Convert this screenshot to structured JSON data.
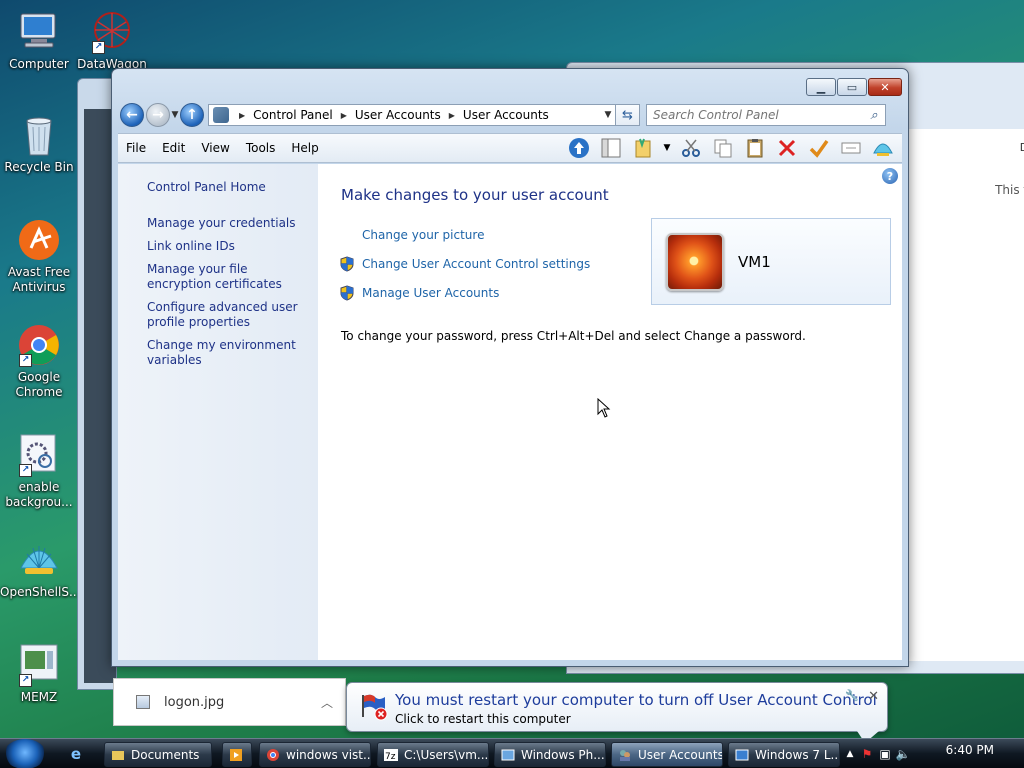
{
  "desktop": {
    "icons": [
      {
        "label": "Computer",
        "icon": "computer-icon"
      },
      {
        "label": "DataWagon",
        "icon": "datawagon-icon"
      },
      {
        "label": "Recycle Bin",
        "icon": "recycle-bin-icon"
      },
      {
        "label": "Avast Free Antivirus",
        "icon": "avast-icon"
      },
      {
        "label": "Google Chrome",
        "icon": "chrome-icon"
      },
      {
        "label": "enable backgrou...",
        "icon": "settings-icon"
      },
      {
        "label": "OpenShellS...",
        "icon": "openshell-icon"
      },
      {
        "label": "MEMZ",
        "icon": "memz-icon"
      }
    ]
  },
  "window": {
    "address": {
      "crumbs": [
        "Control Panel",
        "User Accounts",
        "User Accounts"
      ]
    },
    "search": {
      "placeholder": "Search Control Panel"
    },
    "menu": [
      "File",
      "Edit",
      "View",
      "Tools",
      "Help"
    ],
    "left_pane": {
      "home": "Control Panel Home",
      "links": [
        "Manage your credentials",
        "Link online IDs",
        "Manage your file encryption certificates",
        "Configure advanced user profile properties",
        "Change my environment variables"
      ]
    },
    "main": {
      "heading": "Make changes to your user account",
      "tasks": [
        {
          "label": "Change your picture",
          "shield": false
        },
        {
          "label": "Change User Account Control settings",
          "shield": true
        },
        {
          "label": "Manage User Accounts",
          "shield": true
        }
      ],
      "password_note": "To change your password, press Ctrl+Alt+Del and select Change a password.",
      "user": {
        "name": "VM1"
      }
    }
  },
  "download": {
    "filename": "logon.jpg"
  },
  "balloon": {
    "title": "You must restart your computer to turn off User Account Control",
    "subtitle": "Click to restart this computer"
  },
  "taskbar": {
    "buttons": [
      {
        "label": "Documents",
        "active": false
      },
      {
        "label": "windows vist...",
        "active": false
      },
      {
        "label": "C:\\Users\\vm...",
        "active": false
      },
      {
        "label": "Windows Ph...",
        "active": false
      },
      {
        "label": "User Accounts",
        "active": true
      },
      {
        "label": "Windows 7 L...",
        "active": false
      }
    ],
    "clock": "6:40 PM"
  },
  "bg_window": {
    "col_header": "Da",
    "text": "This fo"
  },
  "colors": {
    "link": "#1e3287",
    "task_link": "#1e64a8",
    "balloon_title": "#1e3d9c"
  }
}
